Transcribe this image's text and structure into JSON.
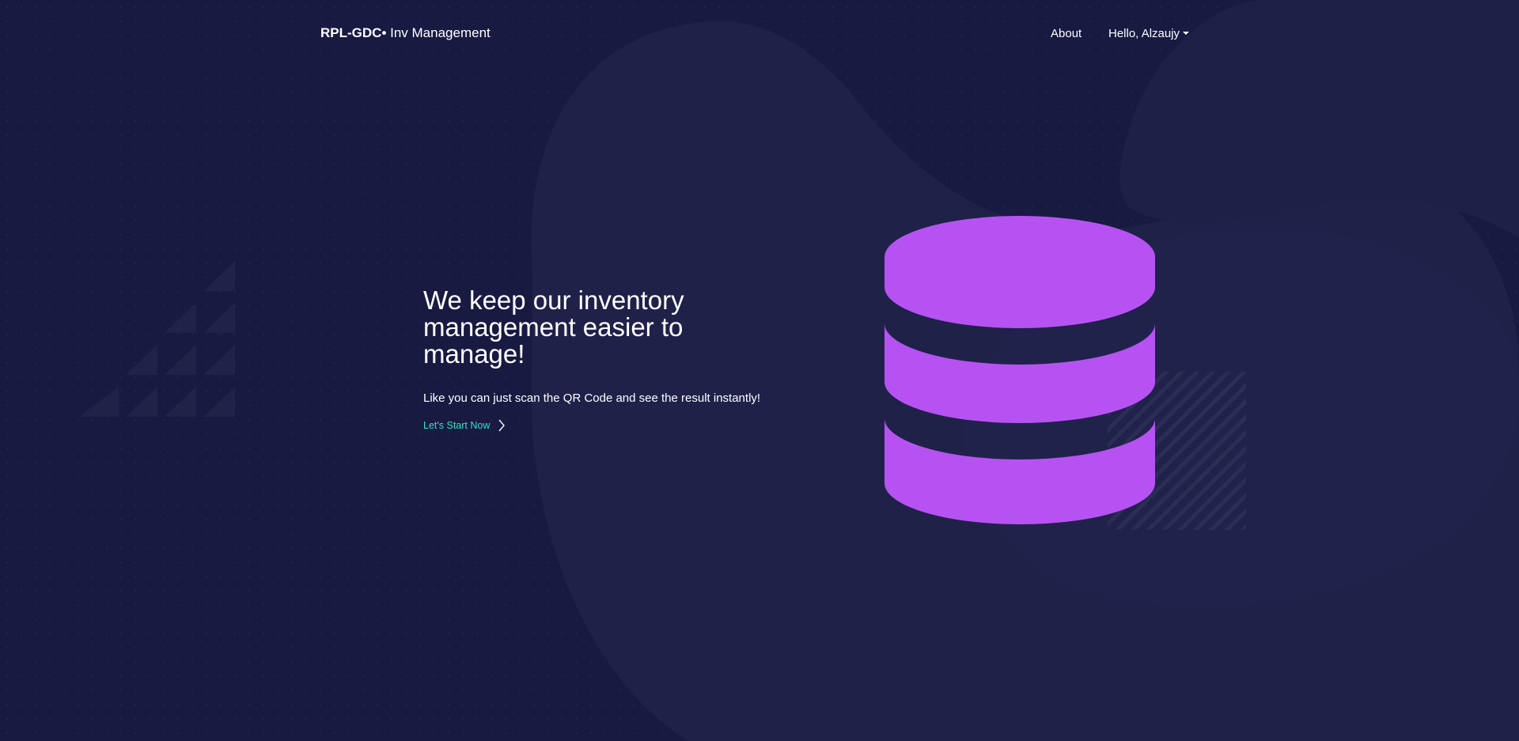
{
  "navbar": {
    "brand_strong": "RPL-GDC•",
    "brand_rest": " Inv Management",
    "about_label": "About",
    "user_label": "Hello, Alzaujy"
  },
  "hero": {
    "title": "We keep our inventory management easier to manage!",
    "subtitle": "Like you can just scan the QR Code and see the result instantly!",
    "cta_label": "Let's Start Now"
  },
  "icons": {
    "database": "database-icon",
    "cta": "chevron-right-icon",
    "user_menu": "caret-down-icon"
  },
  "colors": {
    "background": "#181a42",
    "accent_purple": "#b752f2",
    "accent_teal": "#33e3c5",
    "text": "#ffffff"
  }
}
